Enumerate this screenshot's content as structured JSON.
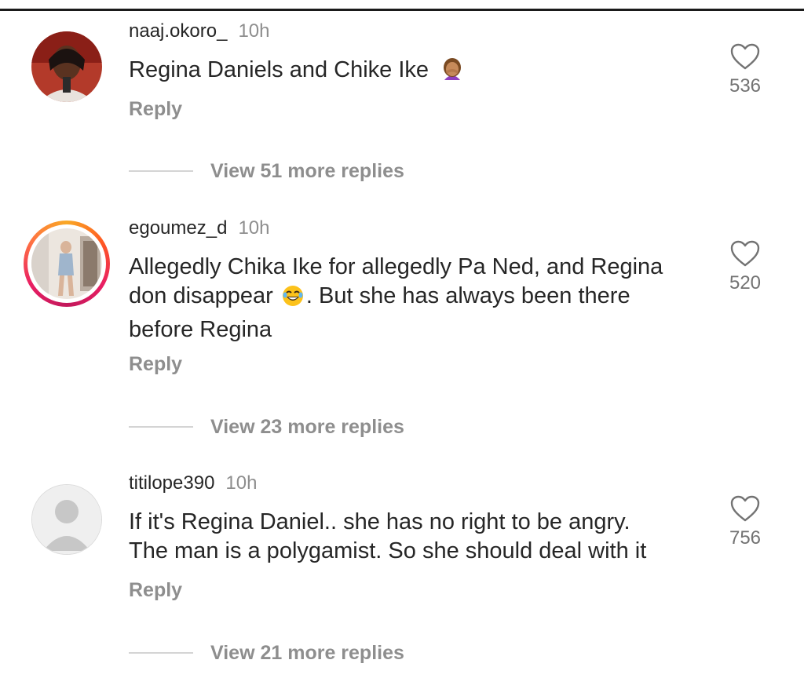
{
  "comments": [
    {
      "username": "naaj.okoro_",
      "time": "10h",
      "text": "Regina Daniels and Chike Ike",
      "emoji": "woman-facepalming-icon",
      "reply_label": "Reply",
      "likes": "536",
      "view_replies": "View 51 more replies"
    },
    {
      "username": "egoumez_d",
      "time": "10h",
      "text_lines": [
        "Allegedly Chika Ike for allegedly Pa Ned, and Regina",
        "don disappear",
        ". But she has always been there",
        "before Regina"
      ],
      "emoji": "laughing-face-icon",
      "reply_label": "Reply",
      "likes": "520",
      "view_replies": "View 23 more replies"
    },
    {
      "username": "titilope390",
      "time": "10h",
      "text_lines": [
        "If it's Regina Daniel.. she has no right to be angry.",
        "The man is a polygamist. So she should deal with it"
      ],
      "reply_label": "Reply",
      "likes": "756",
      "view_replies": "View 21 more replies"
    }
  ],
  "colors": {
    "primary_text": "#262626",
    "secondary_text": "#8e8e8e",
    "story_ring": "#e91e63"
  }
}
